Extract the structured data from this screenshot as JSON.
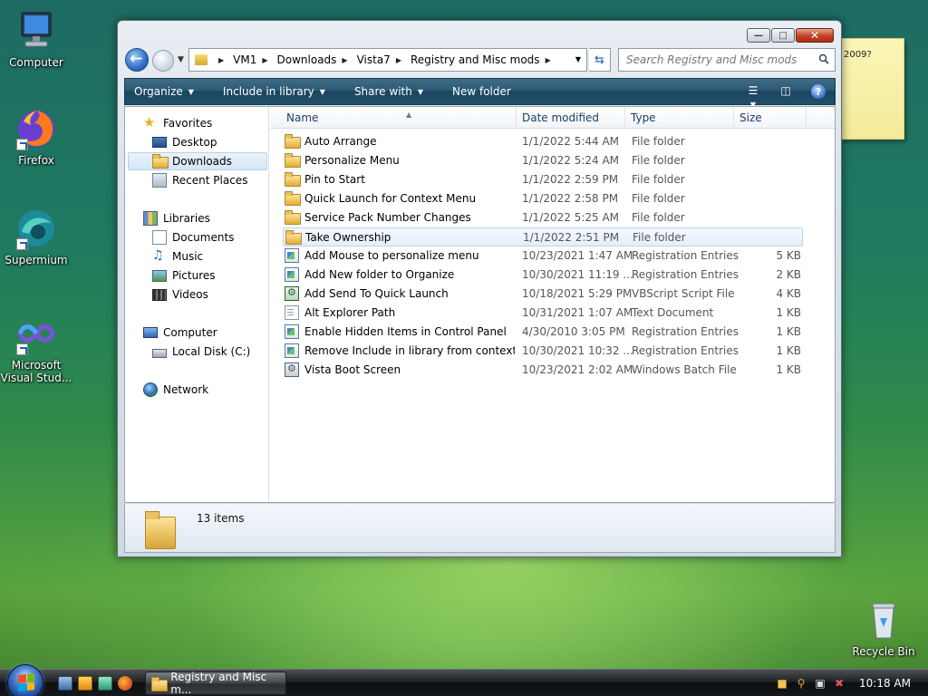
{
  "desktop": {
    "icons": [
      {
        "label": "Computer"
      },
      {
        "label": "Firefox"
      },
      {
        "label": "Supermium"
      },
      {
        "label": "Microsoft Visual Stud..."
      },
      {
        "label": "Recycle Bin"
      }
    ],
    "sticky_text": "2009?"
  },
  "window": {
    "address": {
      "crumbs": [
        "VM1",
        "Downloads",
        "Vista7",
        "Registry and Misc mods"
      ]
    },
    "search": {
      "placeholder": "Search Registry and Misc mods"
    },
    "command_bar": {
      "organize": "Organize",
      "include_in_library": "Include in library",
      "share_with": "Share with",
      "new_folder": "New folder"
    },
    "nav": {
      "favorites": "Favorites",
      "desktop": "Desktop",
      "downloads": "Downloads",
      "recent_places": "Recent Places",
      "libraries": "Libraries",
      "documents": "Documents",
      "music": "Music",
      "pictures": "Pictures",
      "videos": "Videos",
      "computer": "Computer",
      "local_disk": "Local Disk (C:)",
      "network": "Network"
    },
    "columns": {
      "name": "Name",
      "date": "Date modified",
      "type": "Type",
      "size": "Size"
    },
    "files": [
      {
        "name": "Auto Arrange",
        "date": "1/1/2022 5:44 AM",
        "type": "File folder",
        "size": "",
        "icon": "folder"
      },
      {
        "name": "Personalize Menu",
        "date": "1/1/2022 5:24 AM",
        "type": "File folder",
        "size": "",
        "icon": "folder"
      },
      {
        "name": "Pin to Start",
        "date": "1/1/2022 2:59 PM",
        "type": "File folder",
        "size": "",
        "icon": "folder"
      },
      {
        "name": "Quick Launch for Context Menu",
        "date": "1/1/2022 2:58 PM",
        "type": "File folder",
        "size": "",
        "icon": "folder"
      },
      {
        "name": "Service Pack Number Changes",
        "date": "1/1/2022 5:25 AM",
        "type": "File folder",
        "size": "",
        "icon": "folder"
      },
      {
        "name": "Take Ownership",
        "date": "1/1/2022 2:51 PM",
        "type": "File folder",
        "size": "",
        "icon": "folder"
      },
      {
        "name": "Add Mouse to personalize menu",
        "date": "10/23/2021 1:47 AM",
        "type": "Registration Entries",
        "size": "5 KB",
        "icon": "reg"
      },
      {
        "name": "Add New folder to Organize",
        "date": "10/30/2021 11:19 ...",
        "type": "Registration Entries",
        "size": "2 KB",
        "icon": "reg"
      },
      {
        "name": "Add Send To Quick Launch",
        "date": "10/18/2021 5:29 PM",
        "type": "VBScript Script File",
        "size": "4 KB",
        "icon": "vbs"
      },
      {
        "name": "Alt Explorer Path",
        "date": "10/31/2021 1:07 AM",
        "type": "Text Document",
        "size": "1 KB",
        "icon": "txt"
      },
      {
        "name": "Enable Hidden Items in Control Panel",
        "date": "4/30/2010 3:05 PM",
        "type": "Registration Entries",
        "size": "1 KB",
        "icon": "reg"
      },
      {
        "name": "Remove Include in library from context ...",
        "date": "10/30/2021 10:32 ...",
        "type": "Registration Entries",
        "size": "1 KB",
        "icon": "reg"
      },
      {
        "name": "Vista Boot Screen",
        "date": "10/23/2021 2:02 AM",
        "type": "Windows Batch File",
        "size": "1 KB",
        "icon": "bat"
      }
    ],
    "status_count": "13 items"
  },
  "taskbar": {
    "task_button": "Registry and Misc m...",
    "clock": "10:18 AM"
  }
}
